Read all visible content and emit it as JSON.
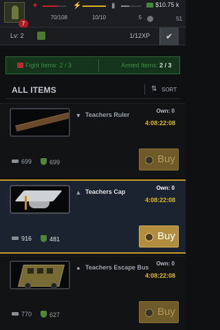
{
  "status": {
    "level_badge": "7",
    "health": {
      "text": "70/108",
      "fraction": 0.65
    },
    "energy": {
      "text": "10/10",
      "fraction": 1.0
    },
    "ammo": {
      "text": "5",
      "fraction": 0.4
    },
    "money": "$10.75 k",
    "tokens": "51"
  },
  "level_row": {
    "level": "Lv: 2",
    "xp": "1/12XP",
    "check_icon": "check-icon"
  },
  "filters": {
    "fight_items": "Fight Items: 2 / 3",
    "armed_items_label": "Armed Items: ",
    "armed_items_value": "2 / 3"
  },
  "list": {
    "title": "ALL ITEMS",
    "sort_label": "SORT"
  },
  "items": [
    {
      "name": "Teachers Ruler",
      "own": "Own: 0",
      "timer": "4:08:22:08",
      "attack": "699",
      "defense": "699",
      "buy_label": "Buy"
    },
    {
      "name": "Teachers Cap",
      "own": "Own: 0",
      "timer": "4:08:22:08",
      "attack": "916",
      "defense": "481",
      "buy_label": "Buy"
    },
    {
      "name": "Teachers Escape Bus",
      "own": "Own: 0",
      "timer": "4:08:22:08",
      "attack": "770",
      "defense": "627",
      "buy_label": "Buy"
    }
  ],
  "colors": {
    "accent_gold": "#c79a2a",
    "timer": "#e2bb10",
    "green_tab": "#2c6a36",
    "health": "#c2222a",
    "energy": "#d7b327"
  }
}
